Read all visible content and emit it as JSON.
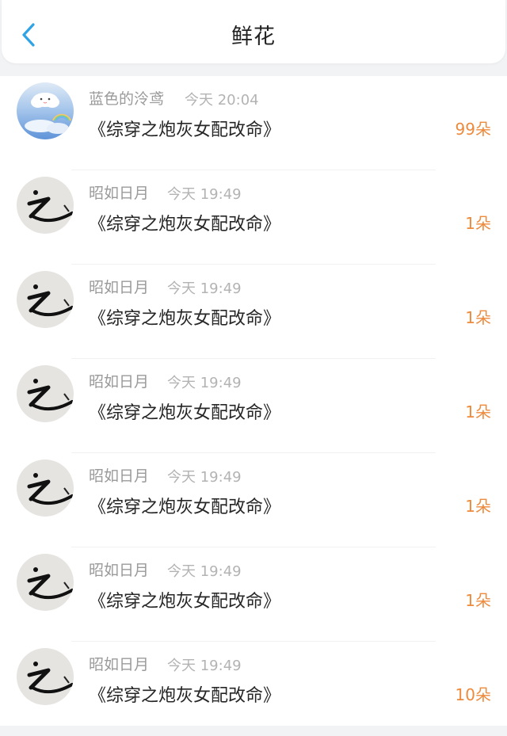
{
  "header": {
    "title": "鲜花",
    "back_icon": "chevron-left-icon",
    "accent_color": "#2fa3e6"
  },
  "count_color": "#ee8a3c",
  "rows": [
    {
      "avatar": "sky-cloud-avatar",
      "user": "蓝色的泠鸢",
      "time": "今天 20:04",
      "book": "《综穿之炮灰女配改命》",
      "count": "99朵"
    },
    {
      "avatar": "calligraphy-avatar",
      "user": "昭如日月",
      "time": "今天 19:49",
      "book": "《综穿之炮灰女配改命》",
      "count": "1朵"
    },
    {
      "avatar": "calligraphy-avatar",
      "user": "昭如日月",
      "time": "今天 19:49",
      "book": "《综穿之炮灰女配改命》",
      "count": "1朵"
    },
    {
      "avatar": "calligraphy-avatar",
      "user": "昭如日月",
      "time": "今天 19:49",
      "book": "《综穿之炮灰女配改命》",
      "count": "1朵"
    },
    {
      "avatar": "calligraphy-avatar",
      "user": "昭如日月",
      "time": "今天 19:49",
      "book": "《综穿之炮灰女配改命》",
      "count": "1朵"
    },
    {
      "avatar": "calligraphy-avatar",
      "user": "昭如日月",
      "time": "今天 19:49",
      "book": "《综穿之炮灰女配改命》",
      "count": "1朵"
    },
    {
      "avatar": "calligraphy-avatar",
      "user": "昭如日月",
      "time": "今天 19:49",
      "book": "《综穿之炮灰女配改命》",
      "count": "10朵"
    }
  ]
}
